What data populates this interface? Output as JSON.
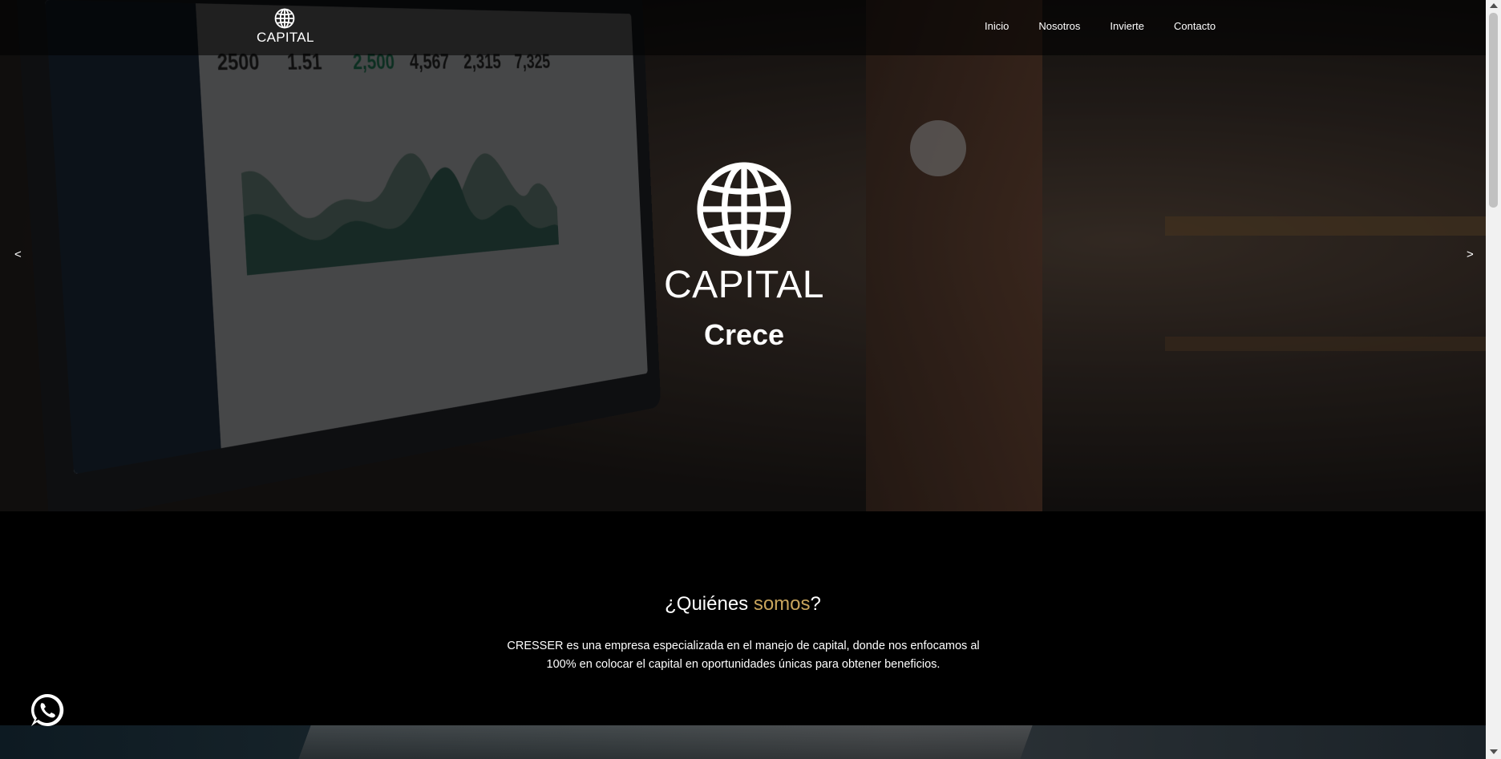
{
  "navbar": {
    "logo_text": "CAPITAL",
    "links": [
      "Inicio",
      "Nosotros",
      "Invierte",
      "Contacto"
    ]
  },
  "hero": {
    "title": "CAPITAL",
    "subtitle": "Crece",
    "prev_label": "<",
    "next_label": ">"
  },
  "about": {
    "title_pre": "¿Quiénes ",
    "title_accent": "somos",
    "title_post": "?",
    "text": "CRESSER es una empresa especializada en el manejo de capital, donde nos enfocamos al 100% en colocar el capital en oportunidades únicas para obtener beneficios."
  },
  "colors": {
    "accent": "#c8a45c",
    "background": "#000000",
    "text": "#ffffff"
  },
  "icons": {
    "logo": "globe-icon",
    "hero_logo": "globe-icon",
    "whatsapp": "whatsapp-icon"
  }
}
